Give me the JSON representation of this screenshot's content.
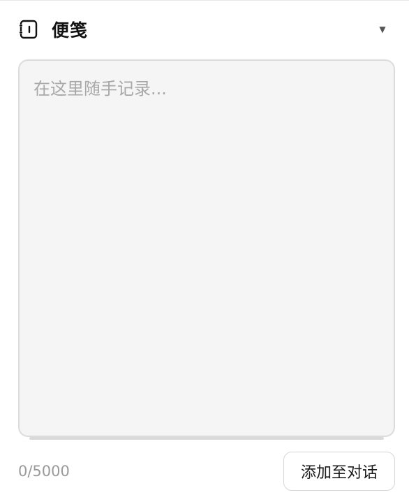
{
  "panel": {
    "title": "便笺",
    "icon": "notepad-icon",
    "collapse_icon": "caret-down-icon",
    "collapse_glyph": "▼"
  },
  "note": {
    "value": "",
    "placeholder": "在这里随手记录..."
  },
  "footer": {
    "counter": "0/5000",
    "add_button_label": "添加至对话"
  }
}
